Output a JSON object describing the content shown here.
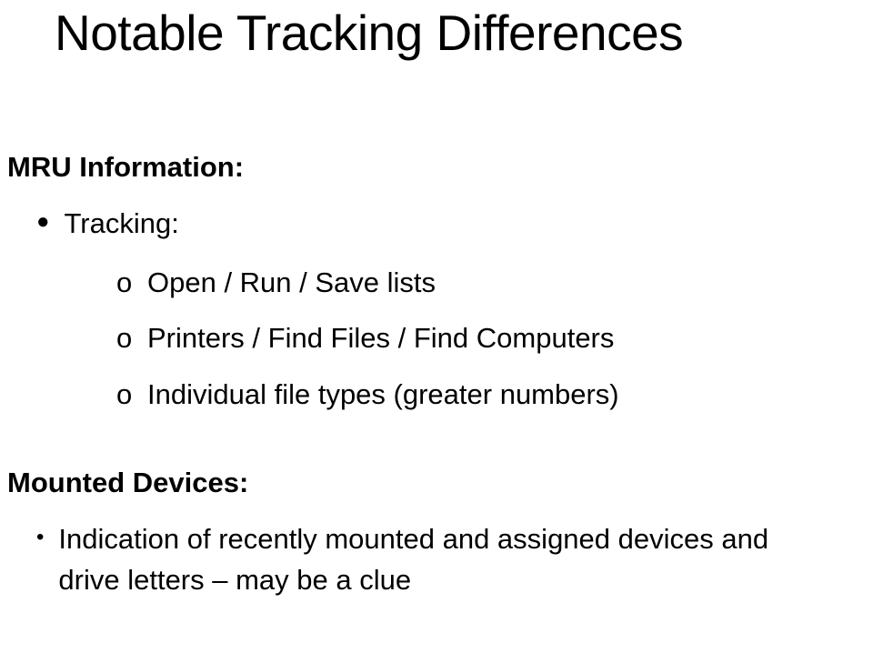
{
  "title": "Notable Tracking Differences",
  "sections": [
    {
      "heading": "MRU Information:",
      "bullets": [
        {
          "label": "Tracking:",
          "subitems": [
            "Open / Run / Save lists",
            "Printers / Find Files / Find Computers",
            "Individual file types (greater numbers)"
          ]
        }
      ]
    },
    {
      "heading": "Mounted Devices:",
      "bullets": [
        {
          "label": "Indication of recently mounted and assigned devices and drive letters – may be a clue"
        }
      ]
    }
  ]
}
